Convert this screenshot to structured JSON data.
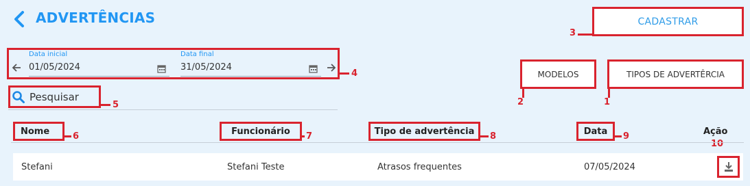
{
  "header": {
    "title": "ADVERTÊNCIAS"
  },
  "actions": {
    "cadastrar": "CADASTRAR",
    "modelos": "MODELOS",
    "tipos": "TIPOS DE ADVERTÊRCIA"
  },
  "filters": {
    "start_label": "Data inicial",
    "start_value": "01/05/2024",
    "end_label": "Data final",
    "end_value": "31/05/2024",
    "search_placeholder": "Pesquisar"
  },
  "table": {
    "columns": [
      "Nome",
      "Funcionário",
      "Tipo de advertência",
      "Data",
      "Ação"
    ],
    "rows": [
      {
        "nome": "Stefani",
        "funcionario": "Stefani Teste",
        "tipo": "Atrasos frequentes",
        "data": "07/05/2024"
      }
    ]
  },
  "annotations": {
    "m1": "1",
    "m2": "2",
    "m3": "3",
    "m4": "4",
    "m5": "5",
    "m6": "6",
    "m7": "7",
    "m8": "8",
    "m9": "9",
    "m10": "10"
  },
  "colors": {
    "accent": "#2196f3",
    "annotation": "#d9232e",
    "background": "#e8f3fc"
  },
  "icons": {
    "back": "chevron-left-icon",
    "prev": "arrow-left-icon",
    "next": "arrow-right-icon",
    "calendar": "calendar-icon",
    "search": "search-icon",
    "download": "download-icon"
  }
}
